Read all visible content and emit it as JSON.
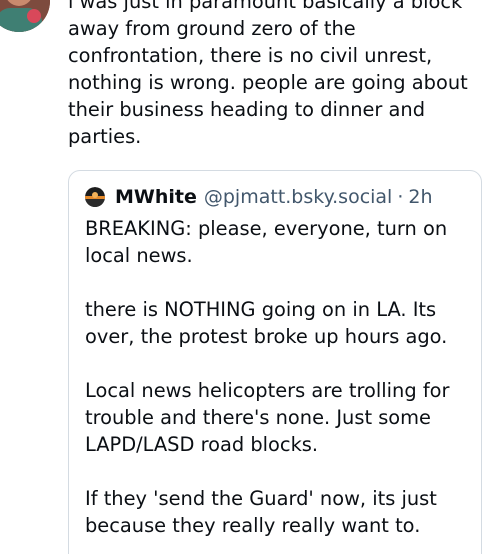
{
  "post": {
    "text": "i was just in paramount basically a block away from ground zero of the confrontation, there is no civil unrest, nothing is wrong. people are going about their business heading to dinner and parties."
  },
  "quote": {
    "author_name": "MWhite",
    "handle": "@pjmatt.bsky.social",
    "separator": "·",
    "time": "2h",
    "text": "BREAKING: please, everyone, turn on local news.\n\nthere is NOTHING going on in LA. Its over, the protest broke up hours ago.\n\nLocal news helicopters are trolling for trouble and there's none. Just some LAPD/LASD road blocks.\n\nIf they 'send the Guard' now, its just because they really really want to."
  },
  "colors": {
    "text": "#0b0f14",
    "muted": "#42576c",
    "border": "#d4dbe2"
  }
}
